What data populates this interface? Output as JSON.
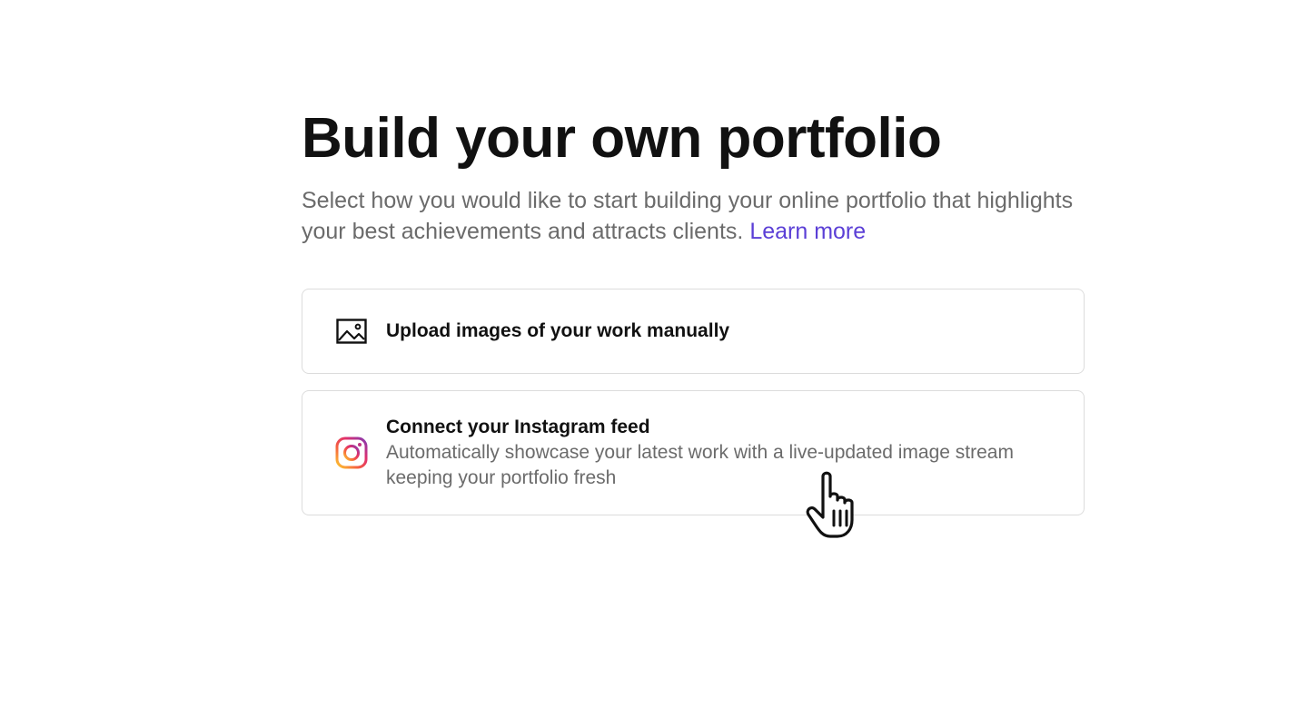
{
  "heading": {
    "title": "Build your own portfolio",
    "subtitle": "Select how you would like to start building your online portfolio that highlights your best achievements and attracts clients.",
    "learn_more": "Learn more"
  },
  "options": {
    "upload": {
      "icon": "image-icon",
      "title": "Upload images of your work manually"
    },
    "instagram": {
      "icon": "instagram-icon",
      "title": "Connect your Instagram feed",
      "description": "Automatically showcase your latest work with a live-updated image stream keeping your portfolio fresh"
    }
  },
  "colors": {
    "link": "#5b3fd6",
    "heading": "#111111",
    "muted": "#6b6b6b",
    "border": "#dcdcdc"
  }
}
